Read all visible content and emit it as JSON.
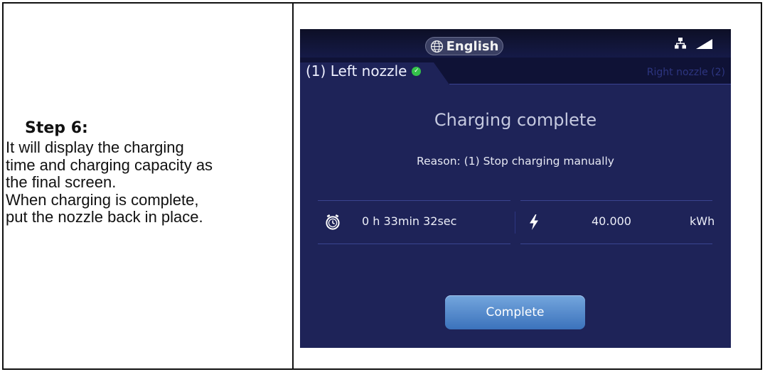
{
  "instructions": {
    "step_title": "Step 6:",
    "lines": [
      "It will display the charging",
      "time and charging capacity as",
      "the final screen.",
      "When charging is complete,",
      "put the nozzle back in place."
    ]
  },
  "screen": {
    "language": "English",
    "icons": [
      "globe-icon",
      "network-icon",
      "signal-icon",
      "clock-icon",
      "bolt-icon",
      "check-icon"
    ],
    "tabs": {
      "left": "(1) Left nozzle",
      "right": "Right nozzle (2)"
    },
    "status_title": "Charging complete",
    "reason": "Reason:  (1) Stop charging manually",
    "charging_time": "0 h 33min 32sec",
    "energy_value": "40.000",
    "energy_unit": "kWh",
    "complete_button": "Complete",
    "colors": {
      "background": "#1e2358",
      "button": "#4f86cc",
      "check": "#34c24a"
    }
  }
}
